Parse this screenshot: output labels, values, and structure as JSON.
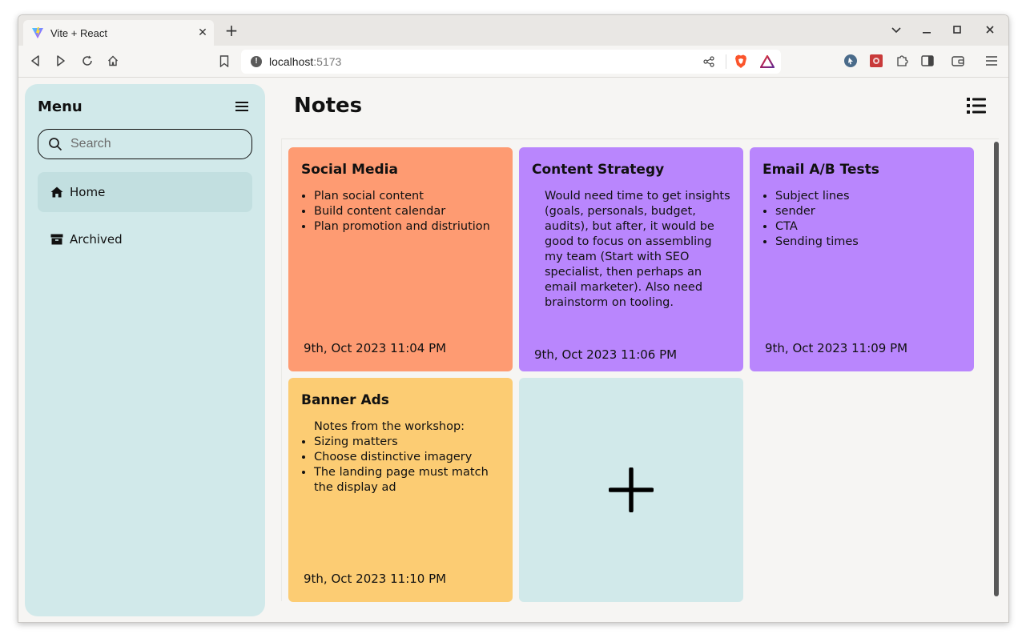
{
  "browser": {
    "tab_title": "Vite + React",
    "url_host": "localhost",
    "url_port": ":5173"
  },
  "sidebar": {
    "title": "Menu",
    "search_placeholder": "Search",
    "items": [
      {
        "label": "Home",
        "icon": "home-icon",
        "active": true
      },
      {
        "label": "Archived",
        "icon": "archive-icon",
        "active": false
      }
    ]
  },
  "main": {
    "title": "Notes"
  },
  "notes": [
    {
      "title": "Social Media",
      "color": "#fe9b72",
      "list": [
        "Plan social content",
        "Build content calendar",
        "Plan promotion and distriution"
      ],
      "date": "9th, Oct 2023 11:04 PM"
    },
    {
      "title": "Content Strategy",
      "color": "#b986fd",
      "text": "Would need time to get insights (goals, personals, budget, audits), but after, it would be good to focus on assembling my team (Start with SEO specialist, then perhaps an email marketer). Also need brainstorm on tooling.",
      "date": "9th, Oct 2023 11:06 PM"
    },
    {
      "title": "Email A/B Tests",
      "color": "#b986fd",
      "list": [
        "Subject lines",
        "sender",
        "CTA",
        "Sending times"
      ],
      "date": "9th, Oct 2023 11:09 PM"
    },
    {
      "title": "Banner Ads",
      "color": "#fccc73",
      "intro": "Notes from the workshop:",
      "list": [
        "Sizing matters",
        "Choose distinctive imagery",
        "The landing page must match the display ad"
      ],
      "date": "9th, Oct 2023 11:10 PM"
    }
  ],
  "colors": {
    "sidebar_bg": "#d1e9ea",
    "page_bg": "#f6f5f3"
  }
}
